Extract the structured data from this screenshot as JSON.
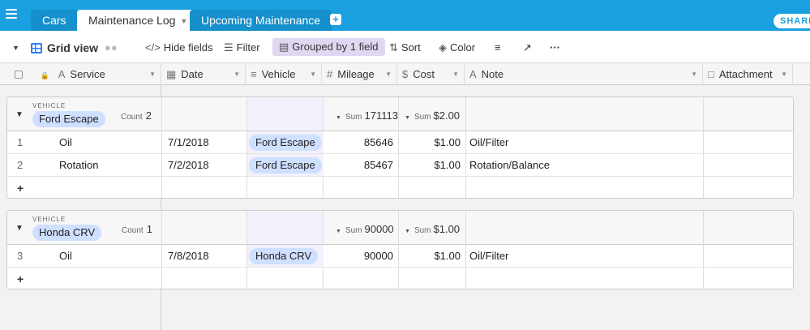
{
  "tabs": [
    {
      "label": "Cars",
      "active": false
    },
    {
      "label": "Maintenance Log",
      "active": true
    },
    {
      "label": "Upcoming Maintenance",
      "active": false
    }
  ],
  "share_label": "SHARE",
  "toolbar": {
    "view_name": "Grid view",
    "hide_fields": "Hide fields",
    "filter": "Filter",
    "grouped": "Grouped by 1 field",
    "sort": "Sort",
    "color": "Color"
  },
  "columns": {
    "service": "Service",
    "date": "Date",
    "vehicle": "Vehicle",
    "mileage": "Mileage",
    "cost": "Cost",
    "note": "Note",
    "attachment": "Attachment"
  },
  "groups": [
    {
      "field_label": "VEHICLE",
      "name": "Ford Escape",
      "count_label": "Count",
      "count": "2",
      "sum_label": "Sum",
      "mileage_sum": "171113",
      "cost_sum": "$2.00",
      "rows": [
        {
          "num": "1",
          "service": "Oil",
          "date": "7/1/2018",
          "vehicle": "Ford Escape",
          "mileage": "85646",
          "cost": "$1.00",
          "note": "Oil/Filter"
        },
        {
          "num": "2",
          "service": "Rotation",
          "date": "7/2/2018",
          "vehicle": "Ford Escape",
          "mileage": "85467",
          "cost": "$1.00",
          "note": "Rotation/Balance"
        }
      ],
      "add_label": "+"
    },
    {
      "field_label": "VEHICLE",
      "name": "Honda CRV",
      "count_label": "Count",
      "count": "1",
      "sum_label": "Sum",
      "mileage_sum": "90000",
      "cost_sum": "$1.00",
      "rows": [
        {
          "num": "3",
          "service": "Oil",
          "date": "7/8/2018",
          "vehicle": "Honda CRV",
          "mileage": "90000",
          "cost": "$1.00",
          "note": "Oil/Filter"
        }
      ],
      "add_label": "+"
    }
  ]
}
